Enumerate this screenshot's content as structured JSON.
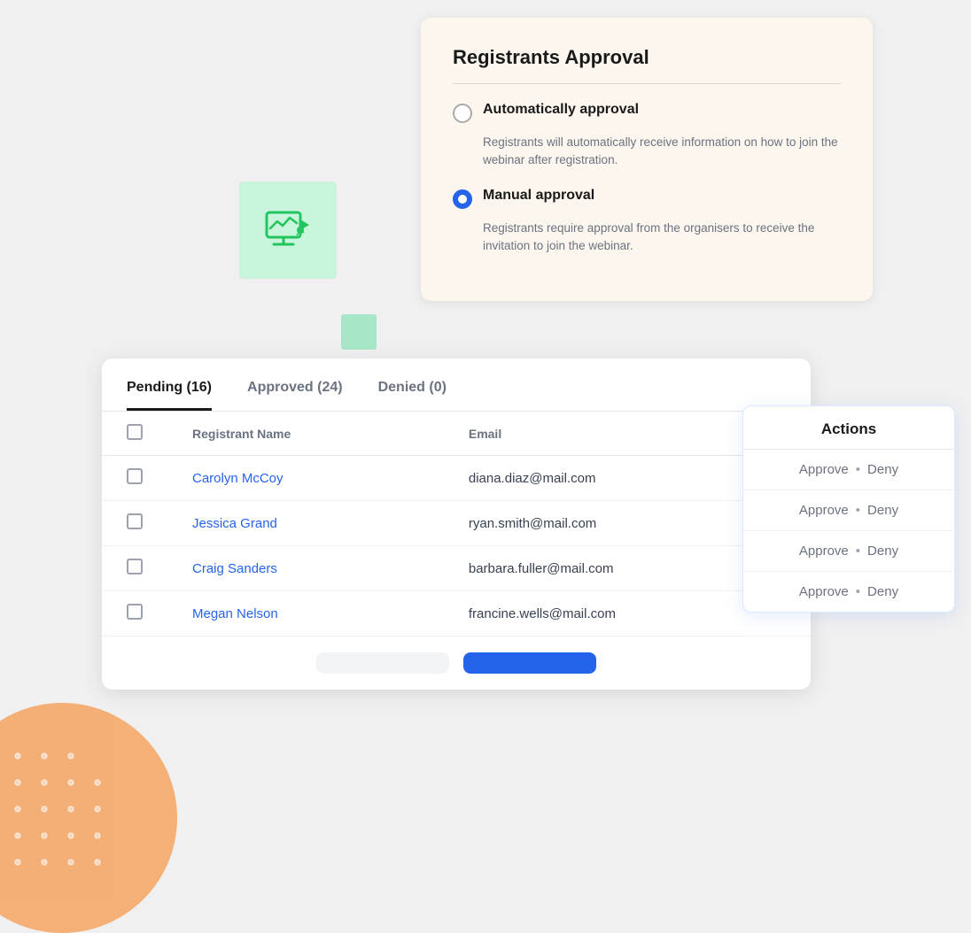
{
  "page": {
    "title": "Registrants Approval"
  },
  "approval": {
    "title": "Registrants Approval",
    "auto_label": "Automatically approval",
    "auto_desc": "Registrants will automatically receive information on how to join the webinar after registration.",
    "manual_label": "Manual approval",
    "manual_desc": "Registrants require approval from the organisers to receive the invitation to join the webinar.",
    "selected": "manual"
  },
  "tabs": [
    {
      "label": "Pending (16)",
      "active": true
    },
    {
      "label": "Approved (24)",
      "active": false
    },
    {
      "label": "Denied (0)",
      "active": false
    }
  ],
  "table": {
    "columns": [
      "Registrant Name",
      "Email"
    ],
    "rows": [
      {
        "name": "Carolyn McCoy",
        "email": "diana.diaz@mail.com"
      },
      {
        "name": "Jessica Grand",
        "email": "ryan.smith@mail.com"
      },
      {
        "name": "Craig Sanders",
        "email": "barbara.fuller@mail.com"
      },
      {
        "name": "Megan Nelson",
        "email": "francine.wells@mail.com"
      }
    ]
  },
  "buttons": {
    "cancel": "",
    "primary": ""
  },
  "actions": {
    "title": "Actions",
    "rows": [
      {
        "approve": "Approve",
        "dot": "•",
        "deny": "Deny"
      },
      {
        "approve": "Approve",
        "dot": "•",
        "deny": "Deny"
      },
      {
        "approve": "Approve",
        "dot": "•",
        "deny": "Deny"
      },
      {
        "approve": "Approve",
        "dot": "•",
        "deny": "Deny"
      }
    ]
  }
}
